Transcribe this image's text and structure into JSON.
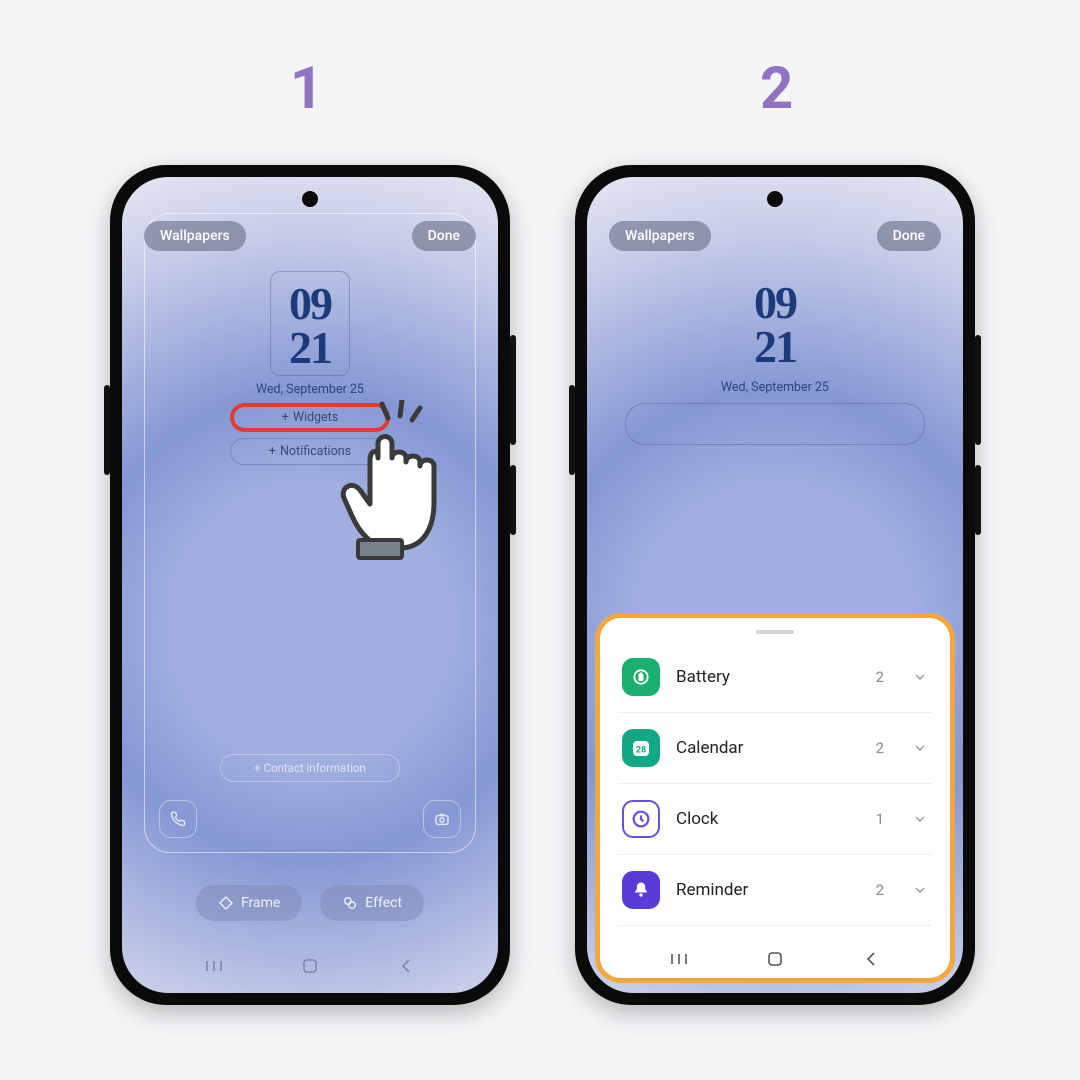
{
  "steps": {
    "one": "1",
    "two": "2"
  },
  "topbar": {
    "wallpapers": "Wallpapers",
    "done": "Done"
  },
  "clock": {
    "hour": "09",
    "minute": "21",
    "date": "Wed, September 25"
  },
  "actions": {
    "widgets": "Widgets",
    "notifications": "Notifications",
    "contact": "Contact information"
  },
  "tools": {
    "frame": "Frame",
    "effect": "Effect"
  },
  "widgets_panel": [
    {
      "label": "Battery",
      "count": "2"
    },
    {
      "label": "Calendar",
      "count": "2"
    },
    {
      "label": "Clock",
      "count": "1"
    },
    {
      "label": "Reminder",
      "count": "2"
    }
  ],
  "calendar_day": "28",
  "icons": {
    "plus": "+"
  }
}
